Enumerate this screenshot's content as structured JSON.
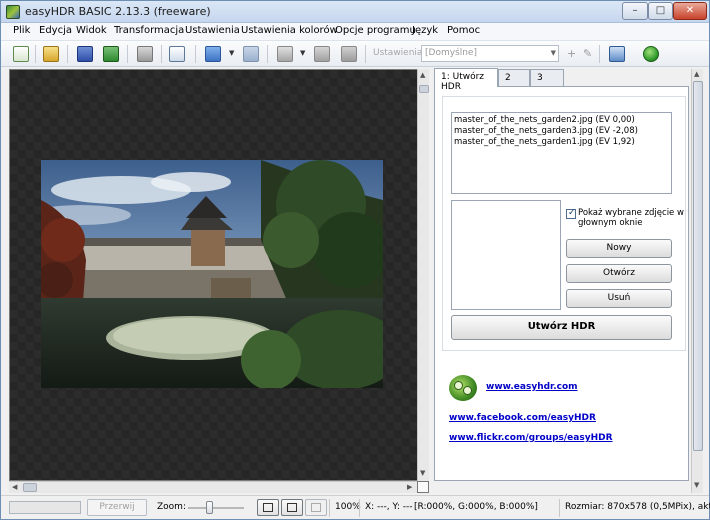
{
  "window": {
    "title": "easyHDR BASIC 2.13.3 (freeware)",
    "minimize": "–",
    "maximize": "□",
    "close": "✕"
  },
  "menu": [
    "Plik",
    "Edycja",
    "Widok",
    "Transformacja",
    "Ustawienia",
    "Ustawienia kolorów",
    "Opcje programu",
    "Język",
    "Pomoc"
  ],
  "toolbar": {
    "icons": [
      "new-icon",
      "open-folder-icon",
      "save-icon",
      "save-as-icon",
      "camera-icon",
      "copy-icon",
      "previous-icon",
      "next-icon",
      "process-icon",
      "disk-icon",
      "align-icon",
      "settings-panel-icon",
      "go-icon"
    ],
    "settings_label": "Ustawienia:",
    "settings_value": "[Domyślne]",
    "add": "+",
    "tool": "✎"
  },
  "tabs": [
    "1: Utwórz HDR",
    "2",
    "3"
  ],
  "panel": {
    "files": [
      "master_of_the_nets_garden2.jpg (EV 0,00)",
      "master_of_the_nets_garden3.jpg (EV -2,08)",
      "master_of_the_nets_garden1.jpg (EV 1,92)"
    ],
    "show_selected_label": "Pokaż wybrane zdjęcie w głownym oknie",
    "new_button": "Nowy",
    "open_button": "Otwórz",
    "remove_button": "Usuń",
    "create_hdr_button": "Utwórz HDR",
    "links": [
      "www.easyhdr.com",
      "www.facebook.com/easyHDR",
      "www.flickr.com/groups/easyHDR"
    ]
  },
  "status": {
    "stop_button": "Przerwij",
    "zoom_label": "Zoom:",
    "zoom_value": "100%",
    "coords": "X: ---, Y: ---",
    "rgb": "[R:000%, G:000%, B:000%]",
    "size": "Rozmiar: 870x578 (0,5MPix), akt"
  },
  "colors": {
    "accent": "#0000c8",
    "canvas_bg": "#2c2c2c",
    "titlebar": "#c5d6ee"
  }
}
